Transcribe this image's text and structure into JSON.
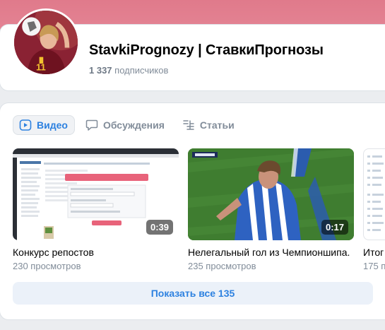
{
  "header": {
    "group_name": "StavkiPrognozy | СтавкиПрогнозы",
    "subscribers_count": "1 337",
    "subscribers_label": "подписчиков"
  },
  "tabs": [
    {
      "label": "Видео",
      "icon": "video-icon",
      "active": true
    },
    {
      "label": "Обсуждения",
      "icon": "chat-bubble-icon",
      "active": false
    },
    {
      "label": "Статьи",
      "icon": "article-lines-icon",
      "active": false
    }
  ],
  "videos": [
    {
      "title": "Конкурс репостов",
      "views": "230 просмотров",
      "duration": "0:39",
      "thumb_label": "Выбрать победителей конкурса репостов"
    },
    {
      "title": "Нелегальный гол из Чемпионшипа.",
      "views": "235 просмотров",
      "duration": "0:17"
    },
    {
      "title": "Итог",
      "views": "175 п",
      "duration": ""
    }
  ],
  "show_all_label": "Показать все 135",
  "colors": {
    "accent": "#2d81e0",
    "cover": "#e07a8b",
    "muted": "#818c99",
    "button_bg": "#ebf1f9"
  }
}
